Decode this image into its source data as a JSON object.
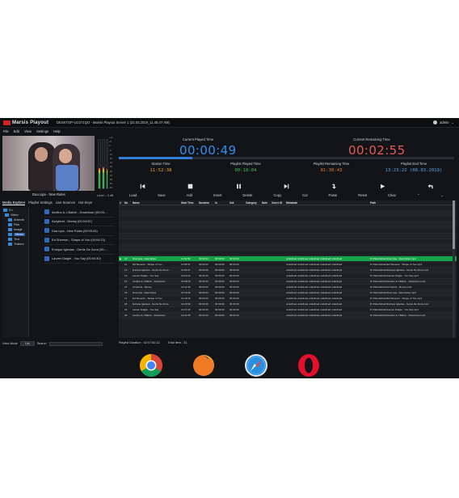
{
  "app": {
    "brand": "Marsis Playout",
    "title_info": "DESKTOP-U1O71QO - Marsis Playout Server 1 (22.03.2019_11.45.47 AM)",
    "user": "admin",
    "menu": [
      "File",
      "Edit",
      "View",
      "Settings",
      "Help"
    ]
  },
  "preview": {
    "now_playing": "Dua Lipa - New Rules",
    "level_label": "Level : -3 dB",
    "vu_scale": [
      "+12",
      "+6",
      "0",
      "-6",
      "-12",
      "-18",
      "-24",
      "-30",
      "-36",
      "-42",
      "-48",
      "-54",
      "-60"
    ],
    "vu_levels": [
      0.42,
      0.44,
      0.4
    ]
  },
  "clocks": {
    "current_played_label": "Current Played Time",
    "current_played": "00:00:49",
    "current_remaining_label": "Current Remaining Time",
    "current_remaining": "00:02:55",
    "progress": 0.22,
    "station_label": "Station Time",
    "station": "11:52:38",
    "playlist_played_label": "Playlist Played Time",
    "playlist_played": "00:18:04",
    "playlist_remaining_label": "Playlist Remaining Time",
    "playlist_remaining": "01:30:43",
    "playlist_end_label": "Playlist End Time",
    "playlist_end": "13:23:22 (08.03.2019)"
  },
  "colors": {
    "played": "#2f8ff0",
    "remaining": "#e85a55",
    "station": "#e3a33b",
    "playlist_played": "#3dbf5c",
    "playlist_remaining": "#e07a3f",
    "playlist_end": "#55a8e8",
    "current_row": "#15a34a"
  },
  "actions": [
    "Load",
    "Save",
    "Add",
    "Insert",
    "Delete",
    "Copy",
    "Cut",
    "Paste",
    "Reset",
    "Clear"
  ],
  "transport_icons": [
    "previous-icon",
    "stop-icon",
    "pause-icon",
    "next-icon",
    "skip-icon",
    "play-icon",
    "return-icon"
  ],
  "left_tabs": [
    "Media Explorer",
    "Playlist Settings",
    "Live Sources",
    "Hot Keys"
  ],
  "tree": {
    "root": "D:\\",
    "folder": "Video",
    "children": [
      "Artwork",
      "Film",
      "Image",
      "Music",
      "Text",
      "Trailers"
    ],
    "selected": "Music"
  },
  "playlist_files": [
    "Avelino & J.Balvin - Downtown (00:03:...",
    "Azzyland - Money (00:04:02)",
    "Dua Lipa - New Rules (00:03:44)",
    "Ed Sheeran - Shape of You (00:04:23)",
    "Enrique Iglesias - Gente De Zona (00:...",
    "Lauren Daigle - You Say (00:04:30)"
  ],
  "view_mode": {
    "label": "View Mode",
    "value": "List",
    "search_label": "Search"
  },
  "grid": {
    "columns": [
      "#",
      "No",
      "Name",
      "Start Time",
      "Duration",
      "In",
      "Out",
      "Category",
      "Note",
      "Genre ID",
      "Metadata",
      "Path"
    ],
    "current_row": {
      "no": "10",
      "name": "Dua Lipa - New Rules",
      "start": "11:51:50",
      "dur": "00:03:44",
      "in": "00:00:00",
      "out": "00:03:44",
      "meta": "undefined.undefined.undefined.undefined.undefined",
      "path": "D:\\Video\\Music\\Dua Lipa - New Rules.mp4"
    },
    "rows": [
      {
        "no": "11",
        "name": "Ed Sheeran - Shape of You",
        "start": "11:55:37",
        "dur": "00:04:23",
        "in": "00:00:00",
        "out": "00:04:23",
        "meta": "undefined.undefined.undefined.undefined.undefined",
        "path": "D:\\Video\\Music\\Ed Sheeran - Shape of You.mp4"
      },
      {
        "no": "12",
        "name": "Enrique Iglesias - Gente De Zona",
        "start": "11:59:37",
        "dur": "00:03:46",
        "in": "00:00:00",
        "out": "00:03:46",
        "meta": "undefined.undefined.undefined.undefined.undefined",
        "path": "D:\\Video\\Music\\Enrique Iglesias - Gente De Zona.mp4"
      },
      {
        "no": "13",
        "name": "Lauren Daigle - You Say",
        "start": "12:03:43",
        "dur": "00:04:30",
        "in": "00:00:00",
        "out": "00:04:30",
        "meta": "undefined.undefined.undefined.undefined.undefined",
        "path": "D:\\Video\\Music\\Lauren Daigle - You Say.mp4"
      },
      {
        "no": "14",
        "name": "Avelino & J.Balvin - Downtown",
        "start": "12:08:13",
        "dur": "00:03:14",
        "in": "00:00:00",
        "out": "00:03:14",
        "meta": "undefined.undefined.undefined.undefined.undefined",
        "path": "D:\\Video\\Music\\Avelino & J.Balvin - Downtown.mp4"
      },
      {
        "no": "15",
        "name": "Azzyland - Money",
        "start": "12:11:30",
        "dur": "00:04:02",
        "in": "00:00:00",
        "out": "00:04:02",
        "meta": "undefined.undefined.undefined.undefined.undefined",
        "path": "D:\\Video\\Music\\Azzyland - Money.mp4"
      },
      {
        "no": "16",
        "name": "Dua Lipa - New Rules",
        "start": "12:15:32",
        "dur": "00:03:44",
        "in": "00:00:00",
        "out": "00:03:44",
        "meta": "undefined.undefined.undefined.undefined.undefined",
        "path": "D:\\Video\\Music\\Dua Lipa - New Rules.mp4"
      },
      {
        "no": "17",
        "name": "Ed Sheeran - Shape of You",
        "start": "12:19:16",
        "dur": "00:04:23",
        "in": "00:00:00",
        "out": "00:04:23",
        "meta": "undefined.undefined.undefined.undefined.undefined",
        "path": "D:\\Video\\Music\\Ed Sheeran - Shape of You.mp4"
      },
      {
        "no": "18",
        "name": "Enrique Iglesias - Gente De Zona",
        "start": "12:23:39",
        "dur": "00:03:46",
        "in": "00:00:00",
        "out": "00:03:46",
        "meta": "undefined.undefined.undefined.undefined.undefined",
        "path": "D:\\Video\\Music\\Enrique Iglesias - Gente De Zona.mp4"
      },
      {
        "no": "19",
        "name": "Lauren Daigle - You Say",
        "start": "12:27:25",
        "dur": "00:04:30",
        "in": "00:00:00",
        "out": "00:04:30",
        "meta": "undefined.undefined.undefined.undefined.undefined",
        "path": "D:\\Video\\Music\\Lauren Daigle - You Say.mp4"
      },
      {
        "no": "20",
        "name": "Avelino & J.Balvin - Downtown",
        "start": "12:31:55",
        "dur": "00:03:14",
        "in": "00:00:00",
        "out": "00:03:14",
        "meta": "undefined.undefined.undefined.undefined.undefined",
        "path": "D:\\Video\\Music\\Avelino & J.Balvin - Downtown.mp4"
      }
    ]
  },
  "status": {
    "duration_label": "Playlist Duration : 02:07:50.12",
    "total_label": "Total Item : 31"
  },
  "browsers": [
    "chrome-icon",
    "firefox-icon",
    "safari-icon",
    "opera-icon"
  ]
}
